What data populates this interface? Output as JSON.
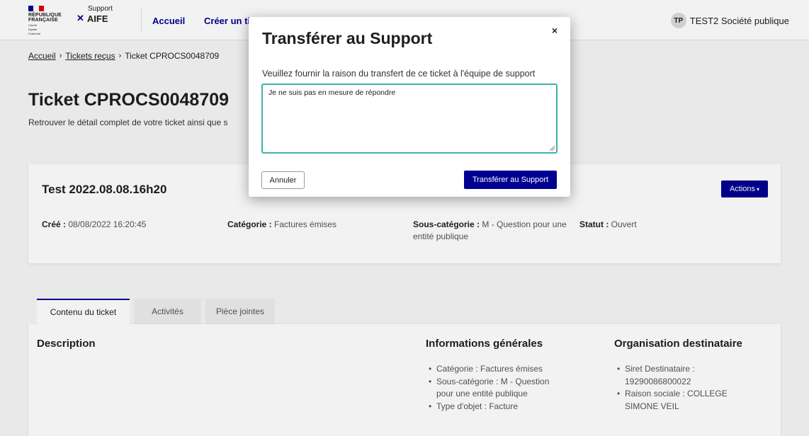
{
  "colors": {
    "primary": "#000091",
    "focus": "#3bb4a4",
    "flag_blue": "#000091",
    "flag_white": "#ffffff",
    "flag_red": "#e1000f"
  },
  "header": {
    "rf_lines": [
      "RÉPUBLIQUE",
      "FRANÇAISE"
    ],
    "devise": [
      "Liberté",
      "Égalité",
      "Fraternité"
    ],
    "support_label": "Support",
    "aife_label": "AIFE",
    "nav": [
      "Accueil",
      "Créer un ti"
    ],
    "user_initials": "TP",
    "user_name": "TEST2 Société publique"
  },
  "breadcrumb": [
    "Accueil",
    "Tickets reçus",
    "Ticket CPROCS0048709"
  ],
  "page": {
    "title": "Ticket CPROCS0048709",
    "subtitle": "Retrouver le détail complet de votre ticket ainsi que s"
  },
  "ticket": {
    "title": "Test 2022.08.08.16h20",
    "actions_label": "Actions",
    "meta": [
      {
        "label": "Créé :",
        "value": "08/08/2022 16:20:45"
      },
      {
        "label": "Catégorie :",
        "value": "Factures émises"
      },
      {
        "label": "Sous-catégorie :",
        "value": "M - Question pour une",
        "value2": "entité publique"
      },
      {
        "label": "Statut :",
        "value": "Ouvert"
      }
    ]
  },
  "tabs": [
    "Contenu du ticket",
    "Activités",
    "Pièce jointes"
  ],
  "content": {
    "description_heading": "Description",
    "info_heading": "Informations générales",
    "info_items": [
      "Catégorie : Factures émises",
      "Sous-catégorie : M - Question pour une entité publique",
      "Type d'objet : Facture"
    ],
    "org_heading": "Organisation destinataire",
    "org_items": [
      "Siret Destinataire : 19290086800022",
      "Raison sociale : COLLEGE SIMONE VEIL"
    ]
  },
  "modal": {
    "title": "Transférer au Support",
    "close_icon": "×",
    "label": "Veuillez fournir la raison du transfert de ce ticket à l'équipe de support",
    "textarea_value": "Je ne suis pas en mesure de répondre",
    "cancel_label": "Annuler",
    "submit_label": "Transférer au Support"
  }
}
